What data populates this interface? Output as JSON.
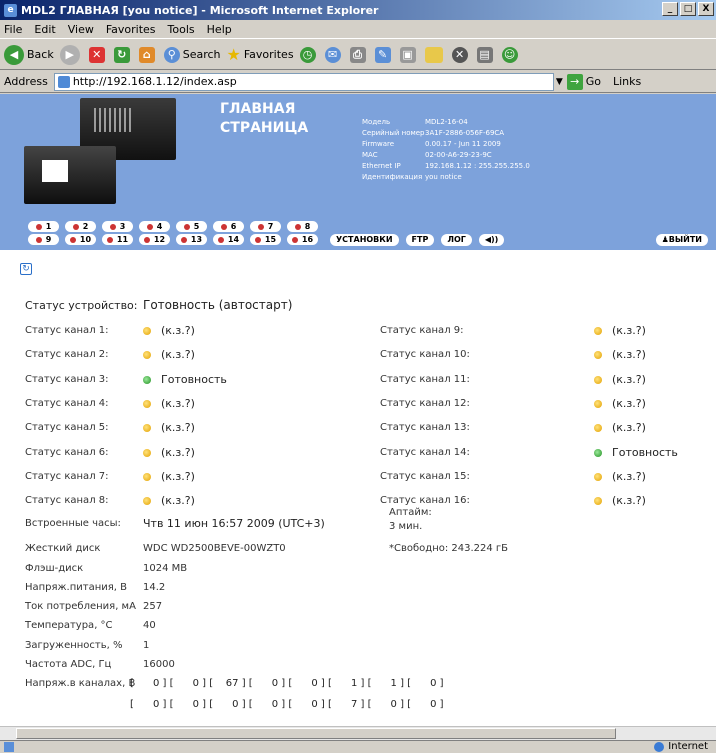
{
  "window": {
    "title": "MDL2 ГЛАВНАЯ [you notice] - Microsoft Internet Explorer",
    "min": "_",
    "max": "□",
    "close": "X"
  },
  "menu": [
    "File",
    "Edit",
    "View",
    "Favorites",
    "Tools",
    "Help"
  ],
  "toolbar": {
    "back": "Back",
    "search": "Search",
    "favorites": "Favorites"
  },
  "address": {
    "label": "Address",
    "url": "http://192.168.1.12/index.asp",
    "go": "Go",
    "links": "Links"
  },
  "banner": {
    "title1": "ГЛАВНАЯ",
    "title2": "СТРАНИЦА",
    "info": [
      {
        "k": "Модель",
        "v": "MDL2-16-04"
      },
      {
        "k": "Серийный номер",
        "v": "3A1F-2886-056F-69CA"
      },
      {
        "k": "Firmware",
        "v": "0.00.17 - Jun 11 2009"
      },
      {
        "k": "MAC",
        "v": "02-00-A6-29-23-9C"
      },
      {
        "k": "Ethernet IP",
        "v": "192.168.1.12 : 255.255.255.0"
      },
      {
        "k": "Идентификация",
        "v": "you notice"
      }
    ],
    "nav1": [
      "1",
      "2",
      "3",
      "4",
      "5",
      "6",
      "7",
      "8"
    ],
    "nav2": [
      "9",
      "10",
      "11",
      "12",
      "13",
      "14",
      "15",
      "16"
    ],
    "actions": [
      "УСТАНОВКИ",
      "FTP",
      "ЛОГ",
      "◀))"
    ],
    "exit": "ВЫЙТИ"
  },
  "status": {
    "device_label": "Статус устройство:",
    "device_value": "Готовность (автостарт)",
    "left": [
      {
        "label": "Статус канал 1:",
        "value": "(к.з.?)",
        "state": "o"
      },
      {
        "label": "Статус канал 2:",
        "value": "(к.з.?)",
        "state": "o"
      },
      {
        "label": "Статус канал 3:",
        "value": "Готовность",
        "state": "g"
      },
      {
        "label": "Статус канал 4:",
        "value": "(к.з.?)",
        "state": "o"
      },
      {
        "label": "Статус канал 5:",
        "value": "(к.з.?)",
        "state": "o"
      },
      {
        "label": "Статус канал 6:",
        "value": "(к.з.?)",
        "state": "o"
      },
      {
        "label": "Статус канал 7:",
        "value": "(к.з.?)",
        "state": "o"
      },
      {
        "label": "Статус канал 8:",
        "value": "(к.з.?)",
        "state": "o"
      }
    ],
    "right": [
      {
        "label": "Статус канал 9:",
        "value": "(к.з.?)",
        "state": "o"
      },
      {
        "label": "Статус канал 10:",
        "value": "(к.з.?)",
        "state": "o"
      },
      {
        "label": "Статус канал 11:",
        "value": "(к.з.?)",
        "state": "o"
      },
      {
        "label": "Статус канал 12:",
        "value": "(к.з.?)",
        "state": "o"
      },
      {
        "label": "Статус канал 13:",
        "value": "(к.з.?)",
        "state": "o"
      },
      {
        "label": "Статус канал 14:",
        "value": "Готовность",
        "state": "g"
      },
      {
        "label": "Статус канал 15:",
        "value": "(к.з.?)",
        "state": "o"
      },
      {
        "label": "Статус канал 16:",
        "value": "(к.з.?)",
        "state": "o"
      }
    ]
  },
  "system": {
    "clock_label": "Встроенные часы:",
    "clock_value": "Чтв 11 июн 16:57 2009 (UTC+3)",
    "uptime_label": "Аптайм:",
    "uptime_value": "3 мин.",
    "hdd_label": "Жесткий диск",
    "hdd_value": "WDC WD2500BEVE-00WZT0",
    "free": "*Свободно: 243.224 гБ",
    "flash_label": "Флэш-диск",
    "flash_value": "1024 MB",
    "voltage_label": "Напряж.питания, В",
    "voltage_value": "14.2",
    "current_label": "Ток потребления, мА",
    "current_value": "257",
    "temp_label": "Температура, °С",
    "temp_value": "40",
    "load_label": "Загруженность, %",
    "load_value": "1",
    "adc_label": "Частота ADC, Гц",
    "adc_value": "16000",
    "chv_label": "Напряж.в каналах, В",
    "chv_row1": "[      0 ] [      0 ] [    67 ] [      0 ] [      0 ] [      1 ] [      1 ] [      0 ]",
    "chv_row2": "[      0 ] [      0 ] [      0 ] [      0 ] [      0 ] [      7 ] [      0 ] [      0 ]"
  },
  "statusbar": {
    "zone": "Internet"
  }
}
